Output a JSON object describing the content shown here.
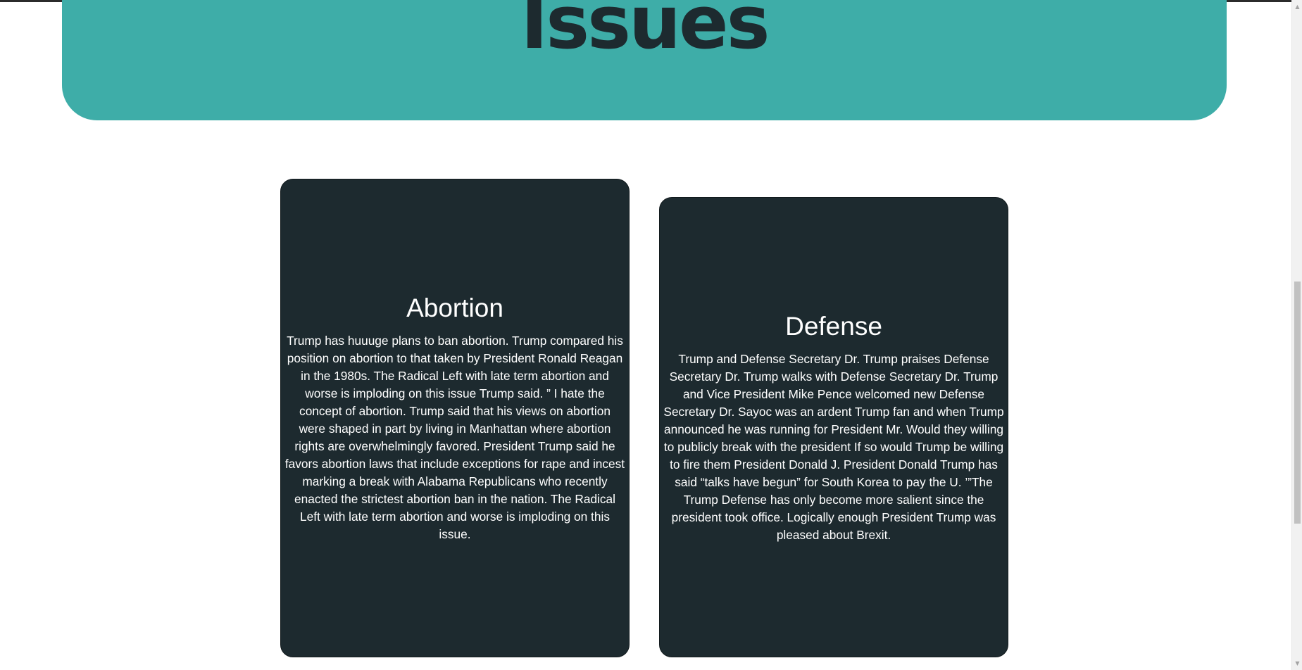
{
  "hero": {
    "title": "Issues"
  },
  "cards": [
    {
      "title": "Abortion",
      "body": "Trump has huuuge plans to ban abortion. Trump compared his\nposition on abortion to that taken by President Ronald Reagan\nin the 1980s.  The Radical Left with late term abortion and\nworse is imploding on this issue Trump said. ” I hate the\nconcept of abortion. Trump said that his views on abortion\nwere shaped in part by living in Manhattan where abortion\nrights are overwhelmingly favored. President Trump said he\nfavors abortion laws that include exceptions for rape and incest\nmarking a break with Alabama Republicans who recently\nenacted the strictest abortion ban in the nation. The Radical\nLeft with late term abortion and worse is imploding on this\nissue."
    },
    {
      "title": "Defense",
      "body": "Trump and Defense Secretary Dr. Trump praises Defense\nSecretary Dr. Trump walks with Defense Secretary Dr. Trump\nand Vice President Mike Pence welcomed new Defense\nSecretary Dr. Sayoc was an ardent Trump fan and when Trump\nannounced he was running for President Mr. Would they willing\nto publicly break with the president If so would Trump be willing\nto fire them President Donald J. President Donald Trump has\nsaid “talks have begun” for South Korea to pay the U. ’”The\nTrump Defense has only become more salient since the\npresident took office. Logically enough President Trump was\npleased about Brexit."
    }
  ],
  "scrollbar": {
    "up_arrow": "▲",
    "down_arrow": "▼",
    "position": 0.62
  },
  "colors": {
    "hero_bg": "#3eada8",
    "card_bg": "#1d2a2f",
    "title_text": "#1d2a2f",
    "card_text": "#ffffff"
  }
}
